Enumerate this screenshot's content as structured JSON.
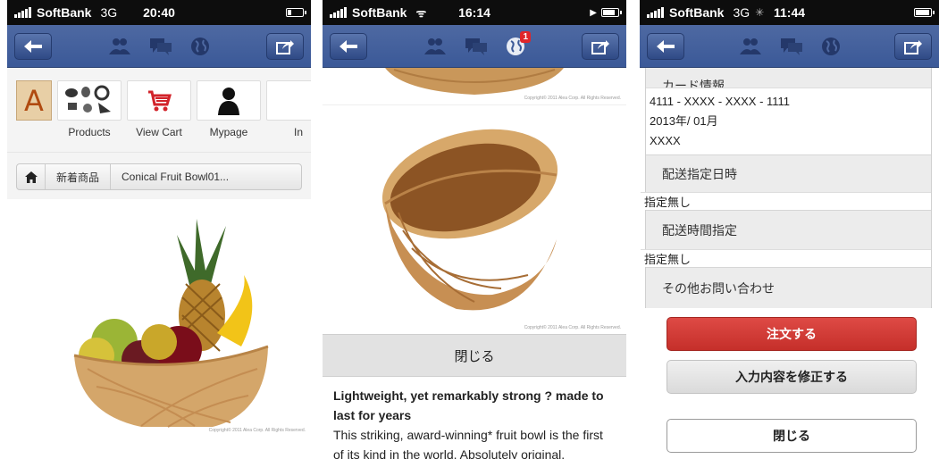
{
  "phone1": {
    "status": {
      "carrier": "SoftBank",
      "network": "3G",
      "time": "20:40"
    },
    "shortcuts": [
      {
        "label": ""
      },
      {
        "label": "Products"
      },
      {
        "label": "View Cart"
      },
      {
        "label": "Mypage"
      },
      {
        "label": "In"
      }
    ],
    "breadcrumb": {
      "items": [
        "新着商品",
        "Conical Fruit Bowl01..."
      ]
    },
    "photo_copyright": "Copyright© 2011 Alea Corp. All Rights Reserved."
  },
  "phone2": {
    "status": {
      "carrier": "SoftBank",
      "time": "16:14"
    },
    "notification_count": "1",
    "top_copyright": "Copyright© 2011 Alea Corp. All Rights Reserved.",
    "bowl_copyright": "Copyright© 2011 Alea Corp. All Rights Reserved.",
    "close_label": "閉じる",
    "description": {
      "title": "Lightweight, yet remarkably strong ? made to last for years",
      "body": "This striking, award-winning* fruit bowl is the first of its kind in the world. Absolutely original."
    }
  },
  "phone3": {
    "status": {
      "carrier": "SoftBank",
      "network": "3G",
      "time": "11:44"
    },
    "card_section_title": "カード情報",
    "card_number": "4111 - XXXX - XXXX - 1111",
    "card_expiry": "2013年/ 01月",
    "card_name": "XXXX",
    "delivery_date_title": "配送指定日時",
    "delivery_date_value": "指定無し",
    "delivery_time_title": "配送時間指定",
    "delivery_time_value": "指定無し",
    "inquiry_title": "その他お問い合わせ",
    "order_button": "注文する",
    "edit_button": "入力内容を修正する",
    "close_button": "閉じる"
  },
  "colors": {
    "nav": "#3b5998",
    "order": "#c8332e"
  }
}
